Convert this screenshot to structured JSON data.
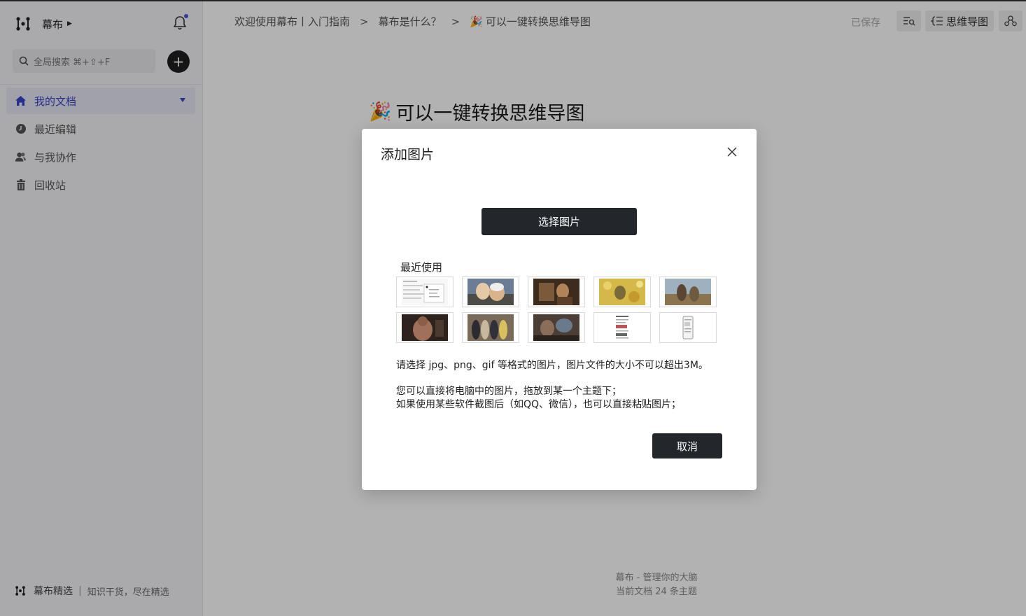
{
  "app": {
    "name": "幕布",
    "saved_status": "已保存",
    "mindmap_label": "思维导图"
  },
  "sidebar": {
    "search_text": "全局搜索 ⌘+⇧+F",
    "items": [
      {
        "label": "我的文档",
        "icon": "home-icon",
        "active": true
      },
      {
        "label": "最近编辑",
        "icon": "clock-icon",
        "active": false
      },
      {
        "label": "与我协作",
        "icon": "users-icon",
        "active": false
      },
      {
        "label": "回收站",
        "icon": "trash-icon",
        "active": false
      }
    ],
    "footer": {
      "title": "幕布精选",
      "subtitle": "知识干货，尽在精选"
    }
  },
  "breadcrumb": {
    "items": [
      "欢迎使用幕布丨入门指南",
      "幕布是什么？",
      "可以一键转换思维导图"
    ],
    "separator": ">"
  },
  "document": {
    "title": "可以一键转换思维导图",
    "title_emoji": "party-popper-icon",
    "footer_line1": "幕布 - 管理你的大脑",
    "footer_line2": "当前文档 24 条主题"
  },
  "modal": {
    "title": "添加图片",
    "choose_button": "选择图片",
    "recent_label": "最近使用",
    "thumbnails": [
      "recent-image-1",
      "recent-image-2",
      "recent-image-3",
      "recent-image-4",
      "recent-image-5",
      "recent-image-6",
      "recent-image-7",
      "recent-image-8",
      "recent-image-9",
      "recent-image-10"
    ],
    "hint_format": "请选择 jpg、png、gif 等格式的图片，图片文件的大小不可以超出3M。",
    "hint_drag": "您可以直接将电脑中的图片，拖放到某一个主题下；",
    "hint_paste": "如果使用某些软件截图后（如QQ、微信），也可以直接粘贴图片；",
    "cancel_button": "取消"
  },
  "colors": {
    "accent": "#3a46c8",
    "dark_button": "#23272c",
    "sidebar_bg": "#f4f4f6"
  }
}
